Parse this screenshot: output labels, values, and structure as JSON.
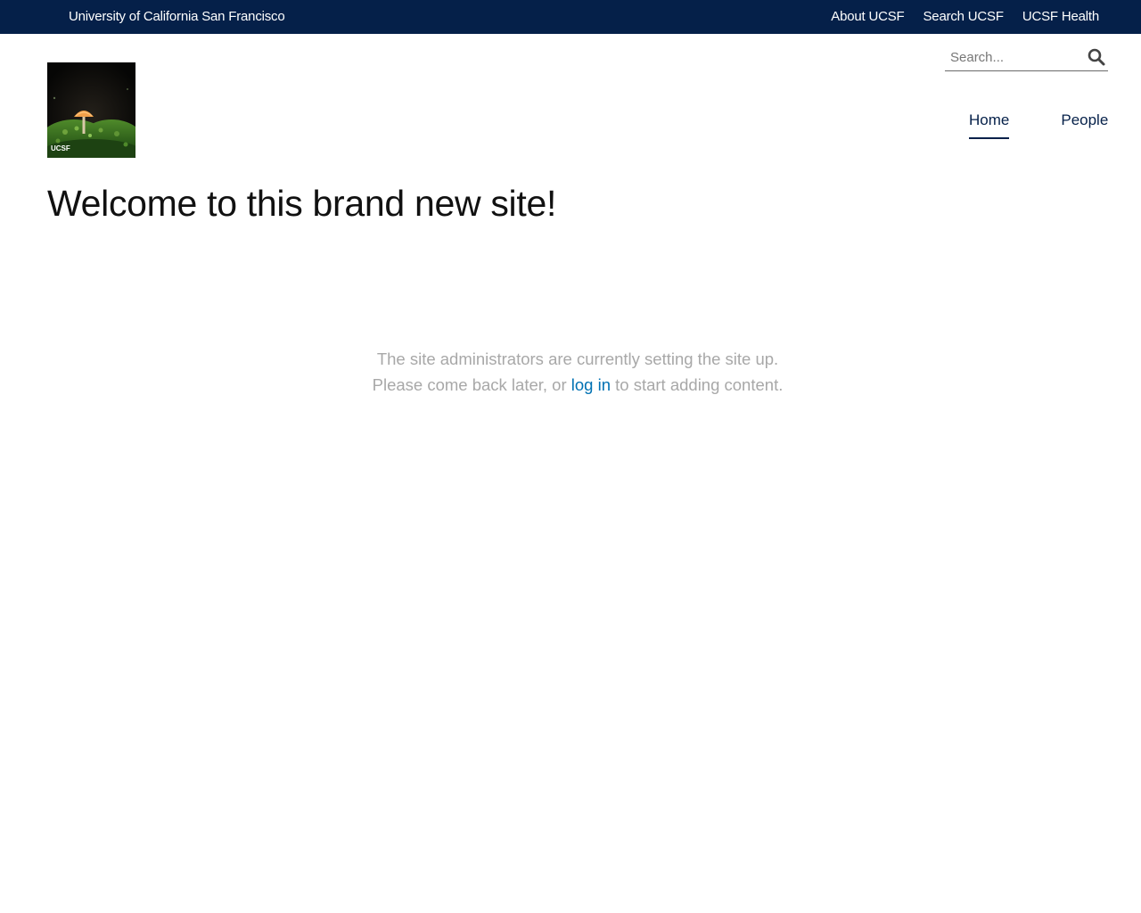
{
  "topbar": {
    "university": "University of California San Francisco",
    "links": [
      "About UCSF",
      "Search UCSF",
      "UCSF Health"
    ]
  },
  "header": {
    "logo_text": "UCSF",
    "search": {
      "placeholder": "Search..."
    },
    "nav": [
      {
        "label": "Home",
        "active": true
      },
      {
        "label": "People",
        "active": false
      }
    ]
  },
  "main": {
    "title": "Welcome to this brand new site!",
    "notice": {
      "line1": "The site administrators are currently setting the site up.",
      "line2_before": "Please come back later, or ",
      "login_link": "log in",
      "line2_after": " to start adding content."
    }
  },
  "colors": {
    "topbar_bg": "#052049",
    "nav_text": "#052049",
    "link": "#0071b3",
    "muted_text": "#a8a8a8"
  }
}
